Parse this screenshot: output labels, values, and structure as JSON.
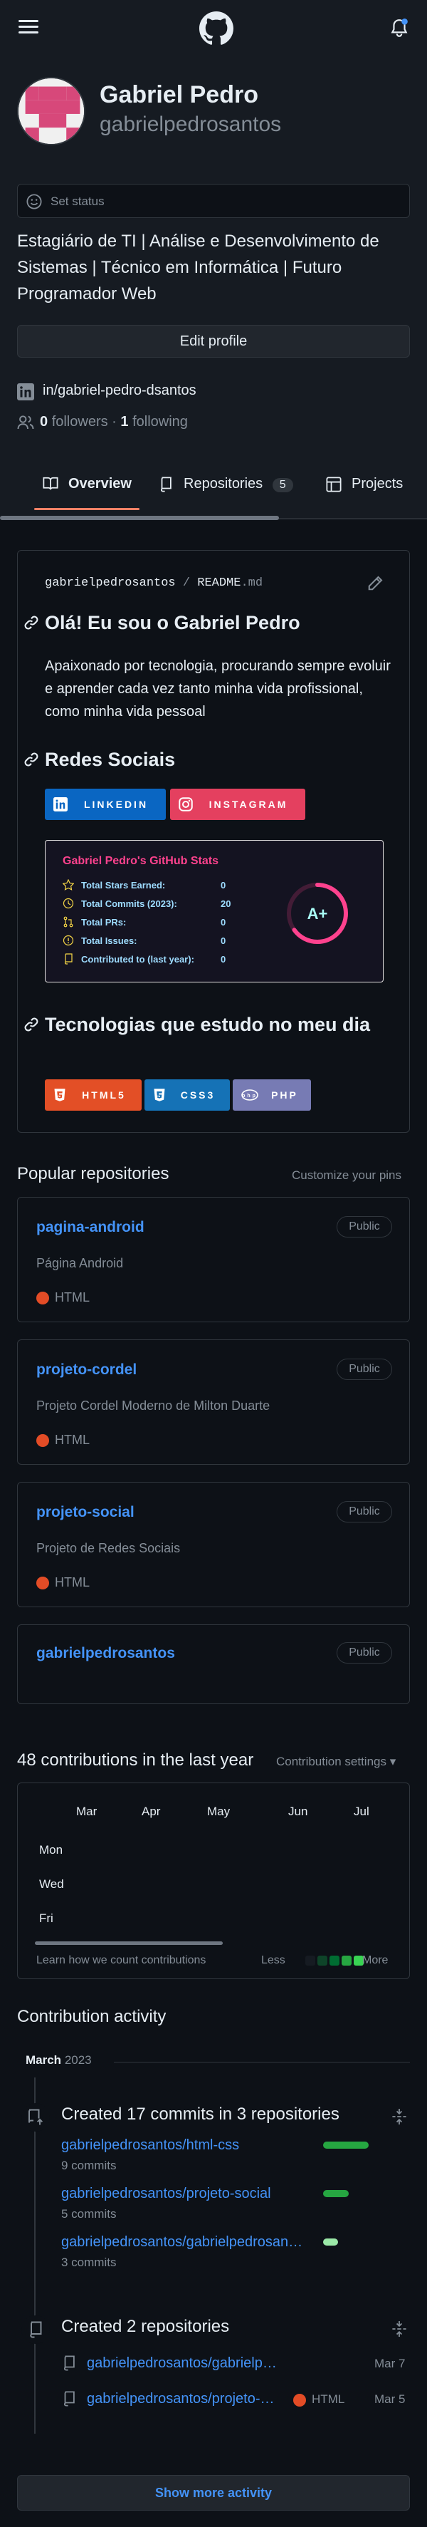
{
  "header": {
    "notification_dot_color": "#4493f8"
  },
  "profile": {
    "name": "Gabriel Pedro",
    "username": "gabrielpedrosantos",
    "status_placeholder": "Set status",
    "bio": "Estagiário de TI | Análise e Desenvolvimento de Sistemas | Técnico em Informática | Futuro Programador Web",
    "edit_label": "Edit profile",
    "linkedin": "in/gabriel-pedro-dsantos",
    "followers_count": "0",
    "followers_label": "followers",
    "separator": "·",
    "following_count": "1",
    "following_label": "following"
  },
  "tabs": [
    {
      "label": "Overview"
    },
    {
      "label": "Repositories",
      "count": "5"
    },
    {
      "label": "Projects"
    }
  ],
  "readme": {
    "path_user": "gabrielpedrosantos",
    "path_sep": "/",
    "path_file": "README",
    "path_ext": ".md",
    "heading": "Olá! Eu sou o Gabriel Pedro",
    "intro": "Apaixonado por tecnologia, procurando sempre evoluir e aprender cada vez tanto minha vida profissional, como minha vida pessoal",
    "social_heading": "Redes Sociais",
    "social_badges": [
      {
        "label": "LINKEDIN",
        "color": "#0a66c2"
      },
      {
        "label": "INSTAGRAM",
        "color": "#e4405f"
      }
    ],
    "stats": {
      "title": "Gabriel Pedro's GitHub Stats",
      "rows": [
        {
          "label": "Total Stars Earned:",
          "value": "0"
        },
        {
          "label": "Total Commits (2023):",
          "value": "20"
        },
        {
          "label": "Total PRs:",
          "value": "0"
        },
        {
          "label": "Total Issues:",
          "value": "0"
        },
        {
          "label": "Contributed to (last year):",
          "value": "0"
        }
      ],
      "grade": "A+",
      "grade_fraction": 0.65,
      "title_color": "#fe428e",
      "ring_color": "#fe428e"
    },
    "tech_heading": "Tecnologias que estudo no meu dia",
    "tech_badges": [
      {
        "label": "HTML5",
        "color": "#e34f26"
      },
      {
        "label": "CSS3",
        "color": "#1572b6"
      },
      {
        "label": "PHP",
        "color": "#777bb4"
      }
    ]
  },
  "popular": {
    "title": "Popular repositories",
    "customize": "Customize your pins",
    "repos": [
      {
        "name": "pagina-android",
        "visibility": "Public",
        "desc": "Página Android",
        "lang": "HTML"
      },
      {
        "name": "projeto-cordel",
        "visibility": "Public",
        "desc": "Projeto Cordel Moderno de Milton Duarte",
        "lang": "HTML"
      },
      {
        "name": "projeto-social",
        "visibility": "Public",
        "desc": "Projeto de Redes Sociais",
        "lang": "HTML"
      },
      {
        "name": "gabrielpedrosantos",
        "visibility": "Public",
        "desc": "",
        "lang": ""
      }
    ]
  },
  "contributions": {
    "title": "48 contributions in the last year",
    "settings": "Contribution settings",
    "months": [
      "Mar",
      "Apr",
      "May",
      "Jun",
      "Jul"
    ],
    "days": [
      "Mon",
      "Wed",
      "Fri"
    ],
    "learn": "Learn how we count contributions",
    "less": "Less",
    "more": "More",
    "legend_colors": [
      "#161b22",
      "#0e4429",
      "#006d32",
      "#26a641",
      "#39d353"
    ]
  },
  "activity": {
    "title": "Contribution activity",
    "month": "March",
    "year": "2023",
    "commits_summary": "Created 17 commits in 3 repositories",
    "commit_repos": [
      {
        "name": "gabrielpedrosantos/html-css",
        "commits": "9 commits",
        "bar_fraction": 1.0
      },
      {
        "name": "gabrielpedrosantos/projeto-social",
        "commits": "5 commits",
        "bar_fraction": 0.56
      },
      {
        "name": "gabrielpedrosantos/gabrielpedrosan…",
        "commits": "3 commits",
        "bar_fraction": 0.33
      }
    ],
    "created_summary": "Created 2 repositories",
    "created_repos": [
      {
        "name": "gabrielpedrosantos/gabrielp…",
        "lang": "",
        "date": "Mar 7"
      },
      {
        "name": "gabrielpedrosantos/projeto-…",
        "lang": "HTML",
        "date": "Mar 5"
      }
    ],
    "show_more": "Show more activity"
  }
}
